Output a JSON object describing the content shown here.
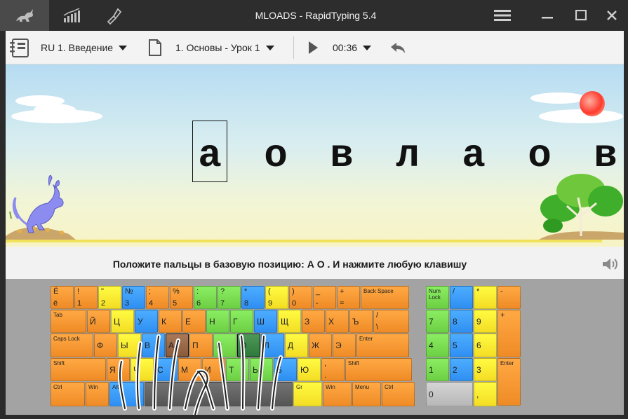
{
  "app": {
    "title": "MLOADS - RapidTyping 5.4"
  },
  "toolbar": {
    "course": "RU 1. Введение",
    "lesson": "1. Основы - Урок 1",
    "timer": "00:36"
  },
  "exercise": {
    "letters": [
      "а",
      "о",
      "в",
      "л",
      "а",
      "о",
      "в"
    ],
    "current_index": 0
  },
  "instruction": "Положите пальцы в базовую позицию:  А  О .  И нажмите любую клавишу",
  "colors": {
    "orange": "#ef8b26",
    "yellow": "#f3dd24",
    "green": "#6ccf44",
    "blue": "#2f8ff2",
    "gray": "#b7b7b7",
    "space": "#555555"
  },
  "keyboard": {
    "main": [
      {
        "top": "Ё",
        "bot": "ё",
        "color": "orange"
      },
      {
        "top": "!",
        "bot": "1",
        "color": "orange"
      },
      {
        "top": "\"",
        "bot": "2",
        "color": "yellow"
      },
      {
        "top": "№",
        "bot": "3",
        "color": "blue"
      },
      {
        "top": ";",
        "bot": "4",
        "color": "orange"
      },
      {
        "top": "%",
        "bot": "5",
        "color": "orange"
      },
      {
        "top": ":",
        "bot": "6",
        "color": "green"
      },
      {
        "top": "?",
        "bot": "7",
        "color": "green"
      },
      {
        "top": "*",
        "bot": "8",
        "color": "blue"
      },
      {
        "top": "(",
        "bot": "9",
        "color": "yellow"
      },
      {
        "top": ")",
        "bot": "0",
        "color": "orange"
      },
      {
        "top": "_",
        "bot": "-",
        "color": "orange"
      },
      {
        "top": "+",
        "bot": "=",
        "color": "orange"
      },
      {
        "small": "Back Space",
        "color": "orange"
      },
      {
        "small": "Tab",
        "color": "orange"
      },
      {
        "mid": "Й",
        "color": "orange"
      },
      {
        "mid": "Ц",
        "color": "yellow"
      },
      {
        "mid": "У",
        "color": "blue"
      },
      {
        "mid": "К",
        "color": "orange"
      },
      {
        "mid": "Е",
        "color": "orange"
      },
      {
        "mid": "Н",
        "color": "green"
      },
      {
        "mid": "Г",
        "color": "green"
      },
      {
        "mid": "Ш",
        "color": "blue"
      },
      {
        "mid": "Щ",
        "color": "yellow"
      },
      {
        "mid": "З",
        "color": "orange"
      },
      {
        "mid": "Х",
        "color": "orange"
      },
      {
        "mid": "Ъ",
        "color": "orange"
      },
      {
        "top": "/",
        "bot": "\\",
        "color": "orange"
      },
      {
        "small": "Caps Lock",
        "color": "orange"
      },
      {
        "mid": "Ф",
        "color": "orange"
      },
      {
        "mid": "Ы",
        "color": "yellow"
      },
      {
        "mid": "В",
        "color": "blue"
      },
      {
        "mid": "А",
        "color": "orange"
      },
      {
        "mid": "П",
        "color": "orange"
      },
      {
        "mid": "Р",
        "color": "green"
      },
      {
        "mid": "О",
        "color": "green"
      },
      {
        "mid": "Л",
        "color": "blue"
      },
      {
        "mid": "Д",
        "color": "yellow"
      },
      {
        "mid": "Ж",
        "color": "orange"
      },
      {
        "mid": "Э",
        "color": "orange"
      },
      {
        "small": "Enter",
        "color": "orange"
      },
      {
        "small": "Shift",
        "color": "orange"
      },
      {
        "mid": "Я",
        "color": "orange"
      },
      {
        "mid": "Ч",
        "color": "yellow"
      },
      {
        "mid": "С",
        "color": "blue"
      },
      {
        "mid": "М",
        "color": "orange"
      },
      {
        "mid": "И",
        "color": "orange"
      },
      {
        "mid": "Т",
        "color": "green"
      },
      {
        "mid": "Ь",
        "color": "green"
      },
      {
        "mid": "Б",
        "color": "blue"
      },
      {
        "mid": "Ю",
        "color": "yellow"
      },
      {
        "top": ",",
        "bot": ".",
        "color": "orange"
      },
      {
        "small": "Shift",
        "color": "orange"
      },
      {
        "small": "Ctrl",
        "color": "orange"
      },
      {
        "small": "Win",
        "color": "orange"
      },
      {
        "small": "Alt",
        "color": "blue"
      },
      {
        "mid": "",
        "color": "space"
      },
      {
        "small": "Gr",
        "color": "yellow"
      },
      {
        "small": "Win",
        "color": "orange"
      },
      {
        "small": "Menu",
        "color": "orange"
      },
      {
        "small": "Ctrl",
        "color": "orange"
      }
    ],
    "numpad": [
      {
        "small": "Num Lock",
        "color": "green"
      },
      {
        "top": "/",
        "color": "blue"
      },
      {
        "top": "*",
        "color": "yellow"
      },
      {
        "top": "-",
        "color": "orange"
      },
      {
        "mid": "7",
        "color": "green"
      },
      {
        "mid": "8",
        "color": "blue"
      },
      {
        "mid": "9",
        "color": "yellow"
      },
      {
        "top": "+",
        "color": "orange"
      },
      {
        "mid": "4",
        "color": "green"
      },
      {
        "mid": "5",
        "color": "blue"
      },
      {
        "mid": "6",
        "color": "yellow"
      },
      {
        "mid": "1",
        "color": "green"
      },
      {
        "mid": "2",
        "color": "blue"
      },
      {
        "mid": "3",
        "color": "yellow"
      },
      {
        "small": "Enter",
        "color": "orange"
      },
      {
        "mid": "0",
        "color": "gray"
      },
      {
        "mid": ",",
        "color": "yellow"
      }
    ]
  }
}
